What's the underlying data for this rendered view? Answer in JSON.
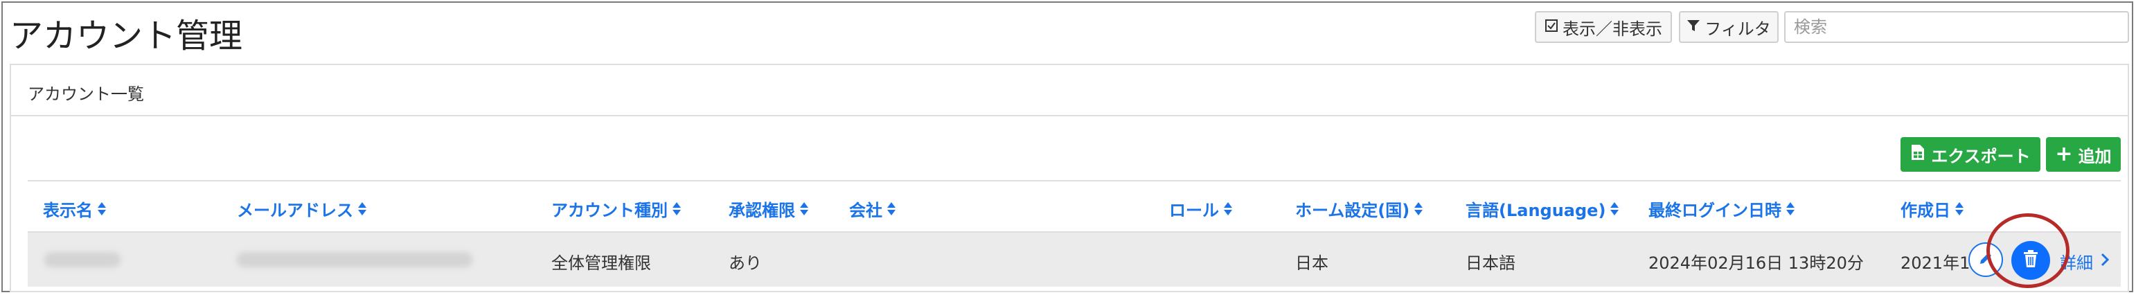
{
  "page": {
    "title": "アカウント管理"
  },
  "toolbar": {
    "toggle_label": "表示／非表示",
    "filter_label": "フィルタ",
    "search_placeholder": "検索"
  },
  "card": {
    "title": "アカウント一覧"
  },
  "actions": {
    "export_label": "エクスポート",
    "add_label": "追加"
  },
  "columns": [
    "表示名",
    "メールアドレス",
    "アカウント種別",
    "承認権限",
    "会社",
    "ロール",
    "ホーム設定(国)",
    "言語(Language)",
    "最終ログイン日時",
    "作成日"
  ],
  "rows": [
    {
      "account_type": "全体管理権限",
      "approval": "あり",
      "home_country": "日本",
      "language": "日本語",
      "last_login": "2024年02月16日 13時20分",
      "created": "2021年12月",
      "detail_label": "詳細"
    }
  ],
  "colors": {
    "accent": "#1a73e8",
    "success": "#28a745",
    "delete": "#0d6efd",
    "highlight": "#b52b27"
  }
}
